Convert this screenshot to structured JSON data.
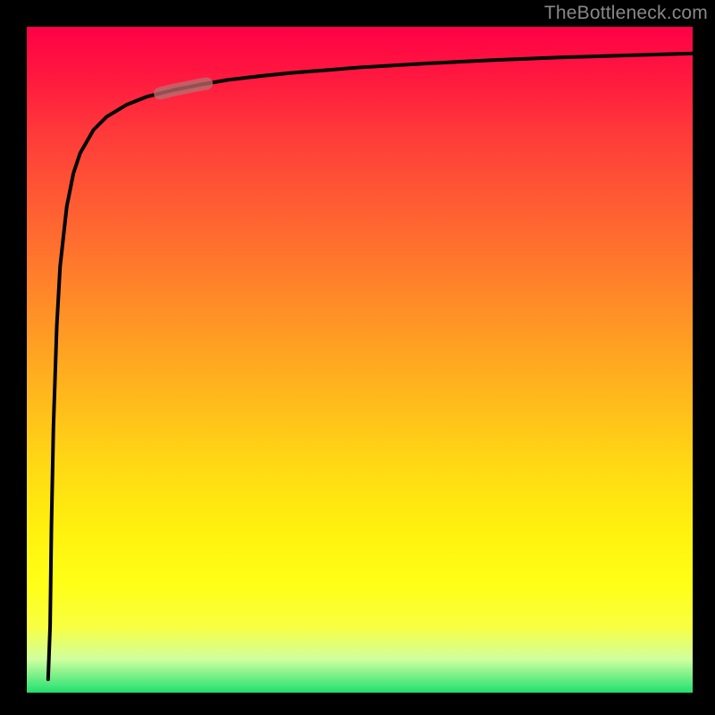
{
  "attribution": "TheBottleneck.com",
  "colors": {
    "gradient_top": "#ff0046",
    "gradient_mid": "#ffff18",
    "gradient_bottom": "#20e070",
    "curve": "#000000",
    "highlight": "#b87070"
  },
  "chart_data": {
    "type": "line",
    "title": "",
    "xlabel": "",
    "ylabel": "",
    "xlim": [
      0,
      100
    ],
    "ylim": [
      0,
      100
    ],
    "grid": false,
    "legend": false,
    "annotations": [
      {
        "type": "highlight_segment",
        "x_range": [
          20,
          27
        ],
        "color": "#b87070"
      }
    ],
    "series": [
      {
        "name": "curve",
        "color": "#000000",
        "x": [
          3.2,
          3.5,
          3.7,
          4.0,
          4.5,
          5.0,
          6.0,
          7.0,
          8.0,
          10.0,
          12.0,
          15.0,
          18.0,
          22.0,
          26.0,
          30.0,
          35.0,
          40.0,
          50.0,
          60.0,
          70.0,
          80.0,
          90.0,
          100.0
        ],
        "y": [
          2.0,
          10.0,
          25.0,
          40.0,
          55.0,
          64.0,
          73.0,
          78.0,
          81.0,
          84.5,
          86.5,
          88.3,
          89.5,
          90.5,
          91.3,
          92.0,
          92.6,
          93.1,
          93.9,
          94.5,
          95.0,
          95.4,
          95.7,
          96.0
        ]
      }
    ]
  }
}
